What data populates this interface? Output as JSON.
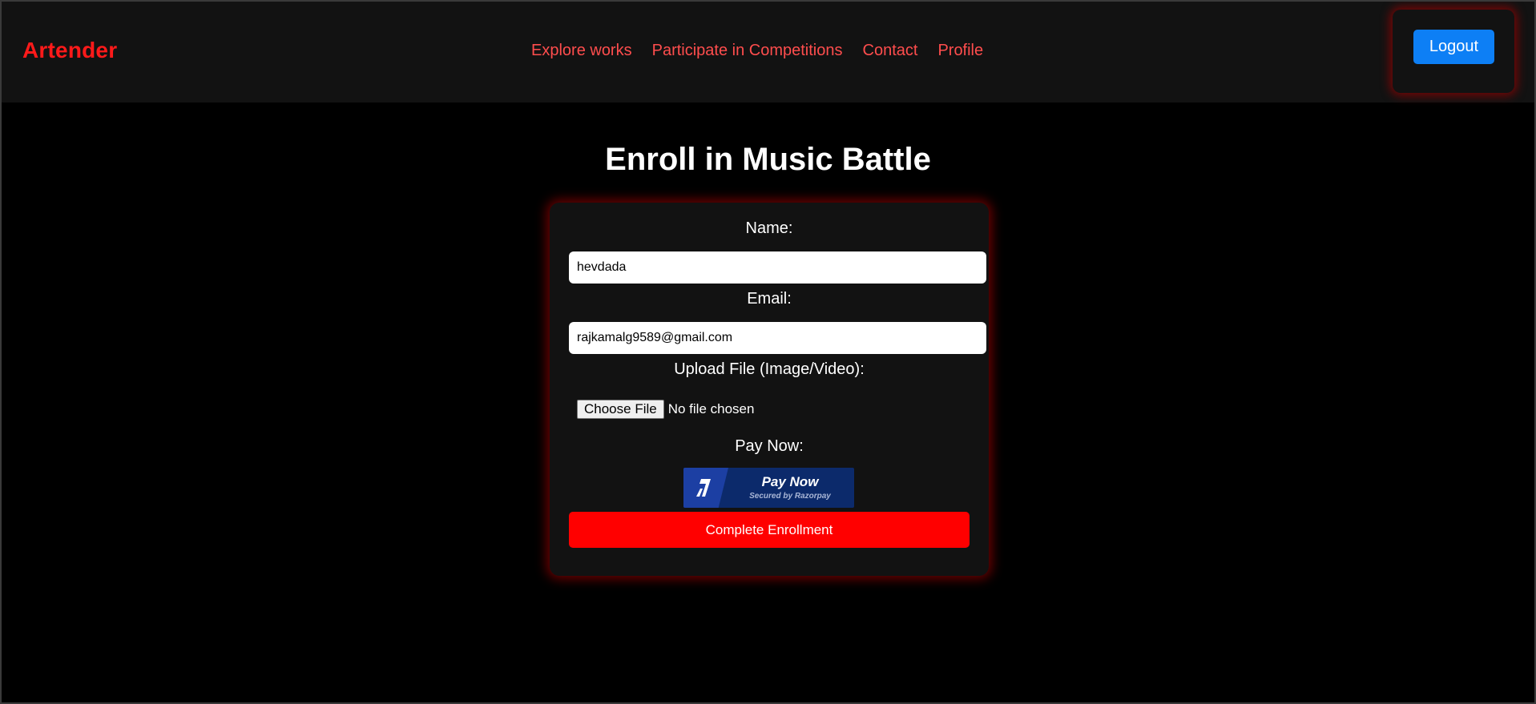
{
  "header": {
    "brand": "Artender",
    "nav": [
      {
        "label": "Explore works"
      },
      {
        "label": "Participate in Competitions"
      },
      {
        "label": "Contact"
      },
      {
        "label": "Profile"
      }
    ],
    "logout_label": "Logout"
  },
  "page": {
    "title": "Enroll in Music Battle"
  },
  "form": {
    "name_label": "Name:",
    "name_value": "hevdada",
    "email_label": "Email:",
    "email_value": "rajkamalg9589@gmail.com",
    "upload_label": "Upload File (Image/Video):",
    "choose_file_label": "Choose File",
    "file_status": "No file chosen",
    "pay_label": "Pay Now:",
    "pay_button_main": "Pay Now",
    "pay_button_sub": "Secured by Razorpay",
    "submit_label": "Complete Enrollment"
  },
  "colors": {
    "brand": "#ff1a1a",
    "nav_link": "#ff4d4d",
    "logout_button": "#0d7ff5",
    "submit_button": "#ff0000",
    "pay_button": "#0c2a6b",
    "card_glow": "#960000"
  },
  "icons": {
    "pay_logo": "razorpay-logo-icon"
  }
}
